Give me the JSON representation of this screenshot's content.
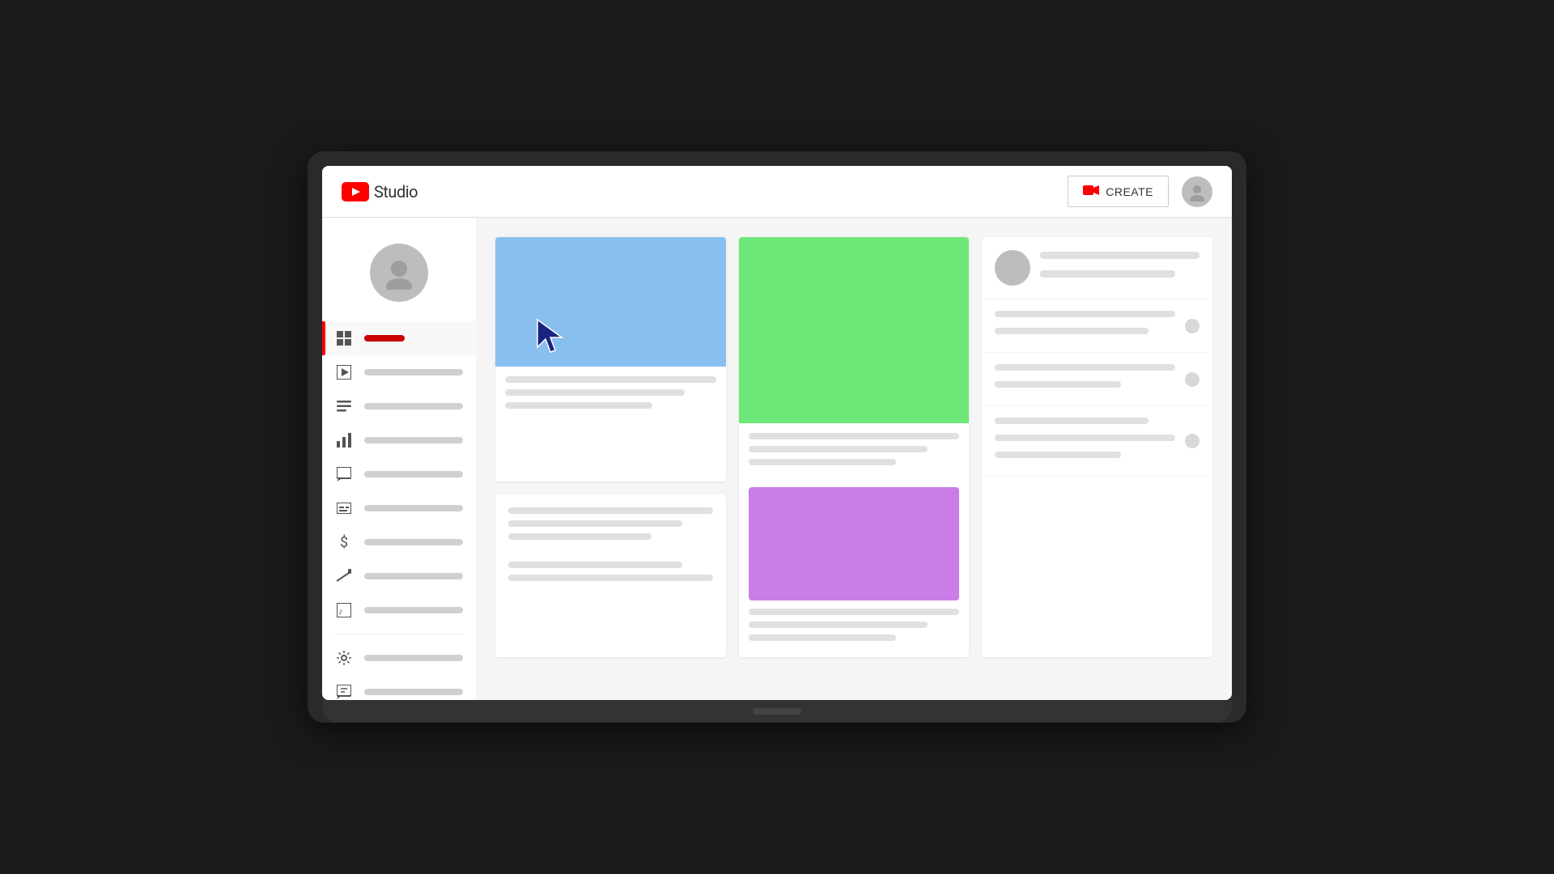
{
  "app": {
    "title": "YouTube Studio",
    "studio_label": "Studio"
  },
  "header": {
    "create_label": "CREATE",
    "create_icon": "▶"
  },
  "sidebar": {
    "items": [
      {
        "id": "dashboard",
        "icon": "⊞",
        "active": true
      },
      {
        "id": "content",
        "icon": "▶"
      },
      {
        "id": "playlists",
        "icon": "☰"
      },
      {
        "id": "analytics",
        "icon": "📊"
      },
      {
        "id": "comments",
        "icon": "💬"
      },
      {
        "id": "subtitles",
        "icon": "⬛"
      },
      {
        "id": "monetization",
        "icon": "$"
      },
      {
        "id": "customization",
        "icon": "✏"
      },
      {
        "id": "audio_library",
        "icon": "🎵"
      }
    ],
    "bottom_items": [
      {
        "id": "settings",
        "icon": "⚙"
      },
      {
        "id": "feedback",
        "icon": "💬"
      }
    ]
  },
  "content": {
    "cards": [
      {
        "id": "card1",
        "thumbnail_color": "#89bfef",
        "has_cursor": true
      },
      {
        "id": "card2",
        "thumbnail_color": "#6fe87a"
      },
      {
        "id": "card3",
        "thumbnail_color": "#c87de8"
      },
      {
        "id": "card4",
        "no_thumbnail": true
      }
    ]
  }
}
